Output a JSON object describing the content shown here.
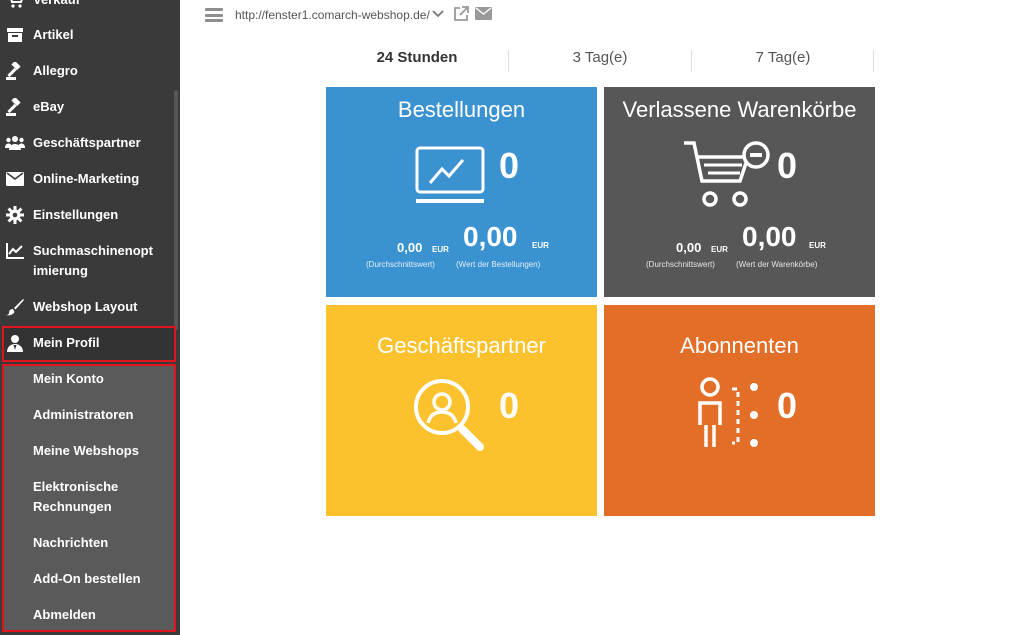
{
  "sidebar": {
    "items": [
      {
        "label": "Verkauf",
        "icon": "cart-icon"
      },
      {
        "label": "Artikel",
        "icon": "archive-icon"
      },
      {
        "label": "Allegro",
        "icon": "gavel-icon"
      },
      {
        "label": "eBay",
        "icon": "gavel-icon"
      },
      {
        "label": "Geschäftspartner",
        "icon": "users-icon"
      },
      {
        "label": "Online-Marketing",
        "icon": "envelope-icon"
      },
      {
        "label": "Einstellungen",
        "icon": "gear-icon"
      },
      {
        "label": "Suchmaschinenopt",
        "label2": "imierung",
        "icon": "line-chart-icon"
      },
      {
        "label": "Webshop Layout",
        "icon": "brush-icon"
      },
      {
        "label": "Mein Profil",
        "icon": "user-icon"
      }
    ],
    "submenu": [
      {
        "label": "Mein Konto"
      },
      {
        "label": "Administratoren"
      },
      {
        "label": "Meine Webshops"
      },
      {
        "label": "Elektronische",
        "label2": "Rechnungen"
      },
      {
        "label": "Nachrichten"
      },
      {
        "label": "Add-On bestellen"
      },
      {
        "label": "Abmelden"
      }
    ]
  },
  "topbar": {
    "url": "http://fenster1.comarch-webshop.de/"
  },
  "tabs": [
    {
      "label": "24 Stunden",
      "active": true
    },
    {
      "label": "3 Tag(e)"
    },
    {
      "label": "7 Tag(e)"
    }
  ],
  "tiles": {
    "orders": {
      "title": "Bestellungen",
      "count": "0",
      "avg_value": "0,00",
      "avg_currency": "EUR",
      "avg_caption": "(Durchschnittswert)",
      "total_value": "0,00",
      "total_currency": "EUR",
      "total_caption": "(Wert der Bestellungen)",
      "color": "#3a92d1"
    },
    "carts": {
      "title": "Verlassene Warenkörbe",
      "count": "0",
      "avg_value": "0,00",
      "avg_currency": "EUR",
      "avg_caption": "(Durchschnittswert)",
      "total_value": "0,00",
      "total_currency": "EUR",
      "total_caption": "(Wert der Warenkörbe)",
      "color": "#575757"
    },
    "partners": {
      "title": "Geschäftspartner",
      "count": "0",
      "color": "#fcc22e"
    },
    "subscribers": {
      "title": "Abonnenten",
      "count": "0",
      "color": "#e26e27"
    }
  }
}
